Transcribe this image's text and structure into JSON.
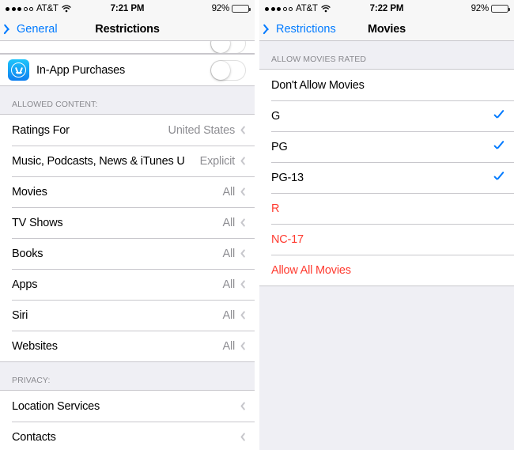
{
  "left": {
    "status_bar": {
      "signal_filled": 3,
      "signal_empty": 2,
      "carrier": "AT&T",
      "wifi_icon": "wifi-icon",
      "time": "7:21 PM",
      "battery_percent": "92%"
    },
    "nav": {
      "back_label": "General",
      "back_icon": "chevron-left-icon",
      "title": "Restrictions"
    },
    "in_app_purchases": {
      "label": "In-App Purchases",
      "icon": "app-store-icon",
      "toggle_state": "off"
    },
    "allowed_content_header": "ALLOWED CONTENT:",
    "allowed_content_rows": [
      {
        "label": "Ratings For",
        "value": "United States"
      },
      {
        "label": "Music, Podcasts, News & iTunes U",
        "value": "Explicit"
      },
      {
        "label": "Movies",
        "value": "All"
      },
      {
        "label": "TV Shows",
        "value": "All"
      },
      {
        "label": "Books",
        "value": "All"
      },
      {
        "label": "Apps",
        "value": "All"
      },
      {
        "label": "Siri",
        "value": "All"
      },
      {
        "label": "Websites",
        "value": "All"
      }
    ],
    "privacy_header": "PRIVACY:",
    "privacy_rows": [
      {
        "label": "Location Services",
        "value": ""
      },
      {
        "label": "Contacts",
        "value": ""
      }
    ]
  },
  "right": {
    "status_bar": {
      "signal_filled": 3,
      "signal_empty": 2,
      "carrier": "AT&T",
      "wifi_icon": "wifi-icon",
      "time": "7:22 PM",
      "battery_percent": "92%"
    },
    "nav": {
      "back_label": "Restrictions",
      "back_icon": "chevron-left-icon",
      "title": "Movies"
    },
    "section_header": "ALLOW MOVIES RATED",
    "rating_rows": [
      {
        "label": "Don't Allow Movies",
        "checked": false,
        "red": false
      },
      {
        "label": "G",
        "checked": true,
        "red": false
      },
      {
        "label": "PG",
        "checked": true,
        "red": false
      },
      {
        "label": "PG-13",
        "checked": true,
        "red": false
      },
      {
        "label": "R",
        "checked": false,
        "red": true
      },
      {
        "label": "NC-17",
        "checked": false,
        "red": true
      },
      {
        "label": "Allow All Movies",
        "checked": false,
        "red": true
      }
    ]
  },
  "colors": {
    "accent_blue": "#007AFF",
    "destructive_red": "#FF3B30",
    "group_background": "#EFEFF4",
    "separator": "#C8C7CC",
    "secondary_text": "#8E8E93"
  }
}
